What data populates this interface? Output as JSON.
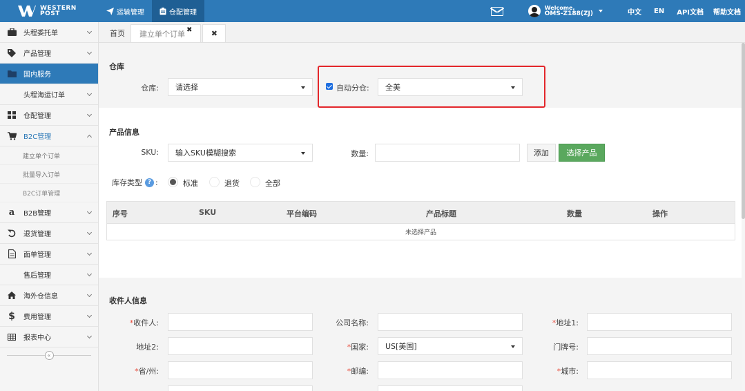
{
  "brand": {
    "line1": "WESTERN",
    "line2": "POST"
  },
  "topnav": [
    {
      "label": "运输管理",
      "icon": "send-icon",
      "active": false
    },
    {
      "label": "仓配管理",
      "icon": "clipboard-icon",
      "active": true
    }
  ],
  "user": {
    "welcome": "Welcome,",
    "name": "OMS-Z188(ZJ)"
  },
  "toplinks": [
    "中文",
    "EN",
    "API文档",
    "帮助文档"
  ],
  "sidebar": {
    "items": [
      {
        "label": "头程委托单",
        "icon": "briefcase-icon"
      },
      {
        "label": "产品管理",
        "icon": "tag-icon"
      },
      {
        "label": "国内服务",
        "icon": "folder-icon"
      },
      {
        "label": "头程海运订单"
      },
      {
        "label": "仓配管理",
        "icon": "grid-icon"
      },
      {
        "label": "B2C管理",
        "icon": "cart-icon"
      },
      {
        "label": "建立单个订单"
      },
      {
        "label": "批量导入订单"
      },
      {
        "label": "B2C订单管理"
      },
      {
        "label": "B2B管理",
        "icon": "amazon-icon"
      },
      {
        "label": "退货管理",
        "icon": "return-icon"
      },
      {
        "label": "面单管理",
        "icon": "document-icon"
      },
      {
        "label": "售后管理"
      },
      {
        "label": "海外仓信息",
        "icon": "home-icon"
      },
      {
        "label": "费用管理",
        "icon": "dollar-icon"
      },
      {
        "label": "报表中心",
        "icon": "table-icon"
      }
    ],
    "collapse": "«"
  },
  "tabs": {
    "home": "首页",
    "current": "建立单个订单",
    "close": "✖",
    "tab_x": "✖"
  },
  "warehouse": {
    "title": "仓库",
    "label": "仓库:",
    "value": "请选择",
    "auto_label": "自动分仓:",
    "auto_value": "全美",
    "auto_checked": true
  },
  "product": {
    "title": "产品信息",
    "sku_label": "SKU:",
    "sku_value": "输入SKU模糊搜索",
    "qty_label": "数量:",
    "qty_value": "",
    "add_label": "添加",
    "select_label": "选择产品",
    "stock_label": "库存类型",
    "stock_colon": ":",
    "help": "?",
    "radios": [
      "标准",
      "退货",
      "全部"
    ],
    "selected_radio": "标准",
    "table": {
      "headers": [
        "序号",
        "SKU",
        "平台编码",
        "产品标题",
        "数量",
        "操作"
      ],
      "empty": "未选择产品"
    }
  },
  "receiver": {
    "title": "收件人信息",
    "fields": {
      "name": {
        "label": "收件人:",
        "required": true,
        "value": ""
      },
      "company": {
        "label": "公司名称:",
        "required": false,
        "value": ""
      },
      "addr1": {
        "label": "地址1:",
        "required": true,
        "value": ""
      },
      "addr2": {
        "label": "地址2:",
        "required": false,
        "value": ""
      },
      "country": {
        "label": "国家:",
        "required": true,
        "value": "US[美国]"
      },
      "door": {
        "label": "门牌号:",
        "required": false,
        "value": ""
      },
      "state": {
        "label": "省/州:",
        "required": true,
        "value": ""
      },
      "zip": {
        "label": "邮编:",
        "required": true,
        "value": ""
      },
      "city": {
        "label": "城市:",
        "required": true,
        "value": ""
      }
    },
    "req_mark": "*"
  },
  "colors": {
    "primary": "#2e7ab8",
    "green": "#5aa85e",
    "highlight": "#e3262a",
    "required": "#e74c3c"
  }
}
